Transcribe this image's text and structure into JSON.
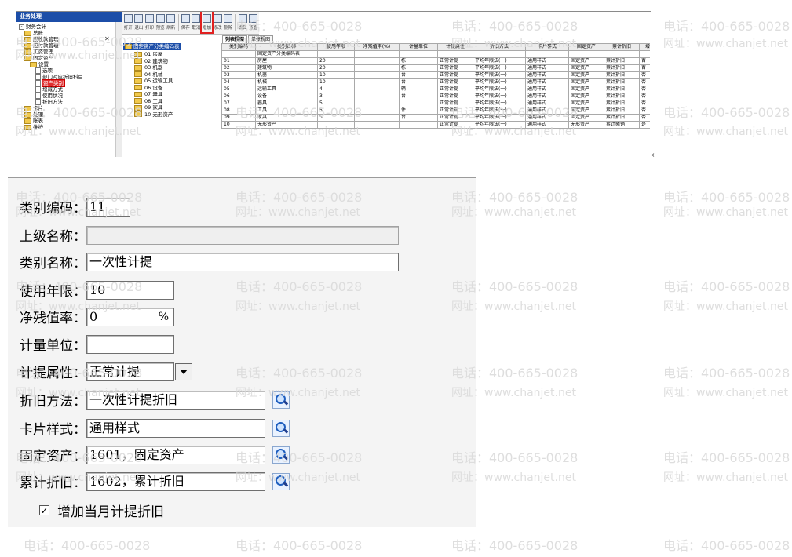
{
  "watermark": {
    "phone": "电话：400-665-0028",
    "web": "网址：www.chanjet.net"
  },
  "app": {
    "nav_title": "业务处理",
    "nav_items": [
      {
        "label": "财务会计",
        "kind": "box",
        "level": 0
      },
      {
        "label": "总账",
        "kind": "fld",
        "level": 1
      },
      {
        "label": "应收款管理",
        "kind": "fld",
        "level": 1
      },
      {
        "label": "应付款管理",
        "kind": "fld",
        "level": 1
      },
      {
        "label": "工资管理",
        "kind": "fld",
        "level": 1
      },
      {
        "label": "固定资产",
        "kind": "fld",
        "level": 1
      },
      {
        "label": "设置",
        "kind": "fld",
        "level": 2
      },
      {
        "label": "选项",
        "kind": "doc",
        "level": 3
      },
      {
        "label": "部门对应折旧科目",
        "kind": "doc",
        "level": 3
      },
      {
        "label": "资产类别",
        "kind": "doc",
        "level": 3,
        "selected": true
      },
      {
        "label": "增减方式",
        "kind": "doc",
        "level": 3
      },
      {
        "label": "使用状况",
        "kind": "doc",
        "level": 3
      },
      {
        "label": "折旧方法",
        "kind": "doc",
        "level": 3
      },
      {
        "label": "卡片",
        "kind": "fld",
        "level": 1
      },
      {
        "label": "处理",
        "kind": "fld",
        "level": 1
      },
      {
        "label": "账表",
        "kind": "fld",
        "level": 1
      },
      {
        "label": "维护",
        "kind": "fld",
        "level": 1
      }
    ],
    "toolbar": [
      {
        "label": "打开",
        "name": "open"
      },
      {
        "label": "退出",
        "name": "exit"
      },
      {
        "label": "打印",
        "name": "print"
      },
      {
        "label": "预览",
        "name": "preview"
      },
      {
        "label": "刷新",
        "name": "refresh"
      },
      {
        "label": "保存",
        "name": "save"
      },
      {
        "label": "取消",
        "name": "cancel"
      },
      {
        "label": "增加",
        "name": "add",
        "highlight": true
      },
      {
        "label": "修改",
        "name": "modify"
      },
      {
        "label": "删除",
        "name": "delete"
      },
      {
        "label": "编辑",
        "name": "edit"
      },
      {
        "label": "查看",
        "name": "view"
      }
    ],
    "view_tabs": [
      "列表视图",
      "单张视图"
    ],
    "tree_root": "固定资产分类编码表",
    "tree_items": [
      "01 房屋",
      "02 建筑物",
      "03 机器",
      "04 机械",
      "05 运输工具",
      "06 设备",
      "07 器具",
      "08 工具",
      "09 家具",
      "10 无形资产"
    ],
    "grid_headers": [
      "类别编码",
      "类别名称",
      "使用年限",
      "净残值率(%)",
      "计量单位",
      "计提属性",
      "折旧方法",
      "卡片样式",
      "固定资产",
      "累计折旧",
      "增加当月计"
    ],
    "grid_rows": [
      [
        "",
        "固定资产分类编码表",
        "",
        "",
        "",
        "",
        "",
        "",
        "",
        "",
        ""
      ],
      [
        "01",
        "房屋",
        "20",
        "",
        "栋",
        "正常计提",
        "平均年限法(一)",
        "通用样式",
        "固定资产",
        "累计折旧",
        "否"
      ],
      [
        "02",
        "建筑物",
        "20",
        "",
        "栋",
        "正常计提",
        "平均年限法(一)",
        "通用样式",
        "固定资产",
        "累计折旧",
        "否"
      ],
      [
        "03",
        "机器",
        "10",
        "",
        "台",
        "正常计提",
        "平均年限法(一)",
        "通用样式",
        "固定资产",
        "累计折旧",
        "否"
      ],
      [
        "04",
        "机械",
        "10",
        "",
        "台",
        "正常计提",
        "平均年限法(一)",
        "通用样式",
        "固定资产",
        "累计折旧",
        "否"
      ],
      [
        "05",
        "运输工具",
        "4",
        "",
        "辆",
        "正常计提",
        "平均年限法(一)",
        "通用样式",
        "固定资产",
        "累计折旧",
        "否"
      ],
      [
        "06",
        "设备",
        "3",
        "",
        "台",
        "正常计提",
        "平均年限法(一)",
        "通用样式",
        "固定资产",
        "累计折旧",
        "否"
      ],
      [
        "07",
        "器具",
        "5",
        "",
        "",
        "正常计提",
        "平均年限法(一)",
        "通用样式",
        "固定资产",
        "累计折旧",
        "否"
      ],
      [
        "08",
        "工具",
        "5",
        "",
        "件",
        "正常计提",
        "平均年限法(一)",
        "通用样式",
        "固定资产",
        "累计折旧",
        "否"
      ],
      [
        "09",
        "家具",
        "5",
        "",
        "台",
        "正常计提",
        "平均年限法(一)",
        "通用样式",
        "固定资产",
        "累计折旧",
        "否"
      ],
      [
        "10",
        "无形资产",
        "",
        "",
        "",
        "正常计提",
        "平均年限法(一)",
        "通用样式",
        "无形资产",
        "累计摊销",
        "是"
      ]
    ]
  },
  "form": {
    "code_label": "类别编码：",
    "code_value": "11",
    "parent_label": "上级名称：",
    "parent_value": "",
    "name_label": "类别名称：",
    "name_value": "一次性计提",
    "life_label": "使用年限：",
    "life_value": "10",
    "residual_label": "净残值率：",
    "residual_value": "0",
    "residual_unit": "%",
    "unit_label": "计量单位：",
    "unit_value": "",
    "accrual_label": "计提属性：",
    "accrual_value": "正常计提",
    "method_label": "折旧方法：",
    "method_value": "一次性计提折旧",
    "card_label": "卡片样式：",
    "card_value": "通用样式",
    "asset_label": "固定资产：",
    "asset_value": "1601，固定资产",
    "accum_label": "累计折旧：",
    "accum_value": "1602，累计折旧",
    "checkbox_label": "增加当月计提折旧",
    "checkbox_checked": true
  }
}
